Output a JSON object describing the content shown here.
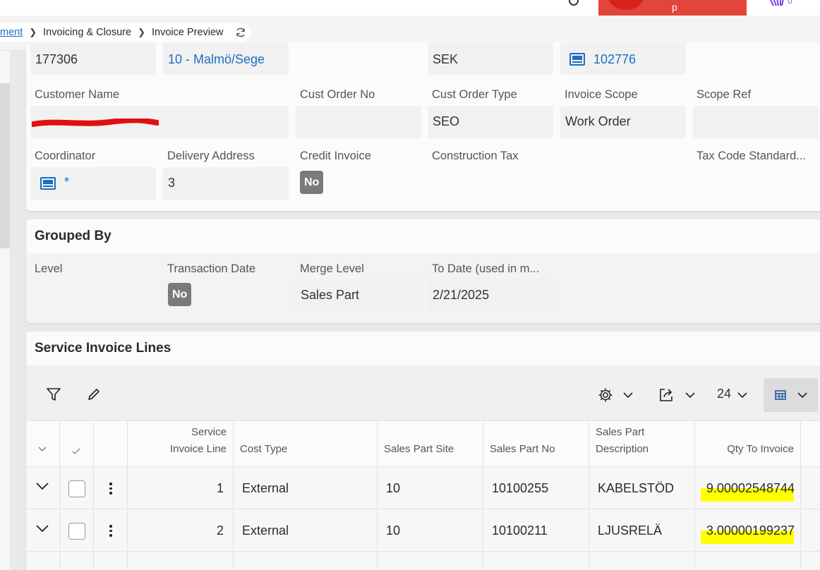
{
  "topbar": {
    "action_label": "p"
  },
  "breadcrumb": {
    "items": [
      "ment",
      "Invoicing & Closure",
      "Invoice Preview"
    ]
  },
  "header_card": {
    "row0": {
      "invoice_no": "177306",
      "site": "10 - Malmö/Sege",
      "currency": "SEK",
      "ref_no": "102776"
    },
    "labels": {
      "customer_name": "Customer Name",
      "cust_order_no": "Cust Order No",
      "cust_order_type": "Cust Order Type",
      "invoice_scope": "Invoice Scope",
      "scope_ref": "Scope Ref",
      "coordinator": "Coordinator",
      "delivery_address": "Delivery Address",
      "credit_invoice": "Credit Invoice",
      "construction_tax": "Construction Tax",
      "tax_code_standard": "Tax Code Standard..."
    },
    "values": {
      "customer_name": "",
      "cust_order_no": "",
      "cust_order_type": "SEO",
      "invoice_scope": "Work Order",
      "scope_ref": "",
      "coordinator": "*",
      "delivery_address": "3",
      "credit_invoice": "No",
      "construction_tax": "",
      "tax_code_standard": ""
    }
  },
  "grouped_by": {
    "title": "Grouped By",
    "labels": {
      "level": "Level",
      "transaction_date": "Transaction Date",
      "merge_level": "Merge Level",
      "to_date": "To Date (used in m..."
    },
    "values": {
      "transaction_date": "No",
      "merge_level": "Sales Part",
      "to_date": "2/21/2025"
    }
  },
  "service_invoice_lines": {
    "title": "Service Invoice Lines",
    "toolbar": {
      "page_size": "24"
    },
    "columns": [
      "Service Invoice Line",
      "Cost Type",
      "Sales Part Site",
      "Sales Part No",
      "Sales Part Description",
      "Qty To Invoice"
    ],
    "rows": [
      {
        "line": "1",
        "cost_type": "External",
        "site": "10",
        "part_no": "10100255",
        "description": "KABELSTÖD",
        "qty": "9.00002548744"
      },
      {
        "line": "2",
        "cost_type": "External",
        "site": "10",
        "part_no": "10100211",
        "description": "LJUSRELÄ",
        "qty": "3.00000199237"
      }
    ]
  },
  "colors": {
    "accent_link": "#1b6ec2",
    "badge_gray": "#7a7a7a",
    "highlight": "#ffff00",
    "redaction": "#e01010",
    "top_panel_red": "#e2453b"
  }
}
